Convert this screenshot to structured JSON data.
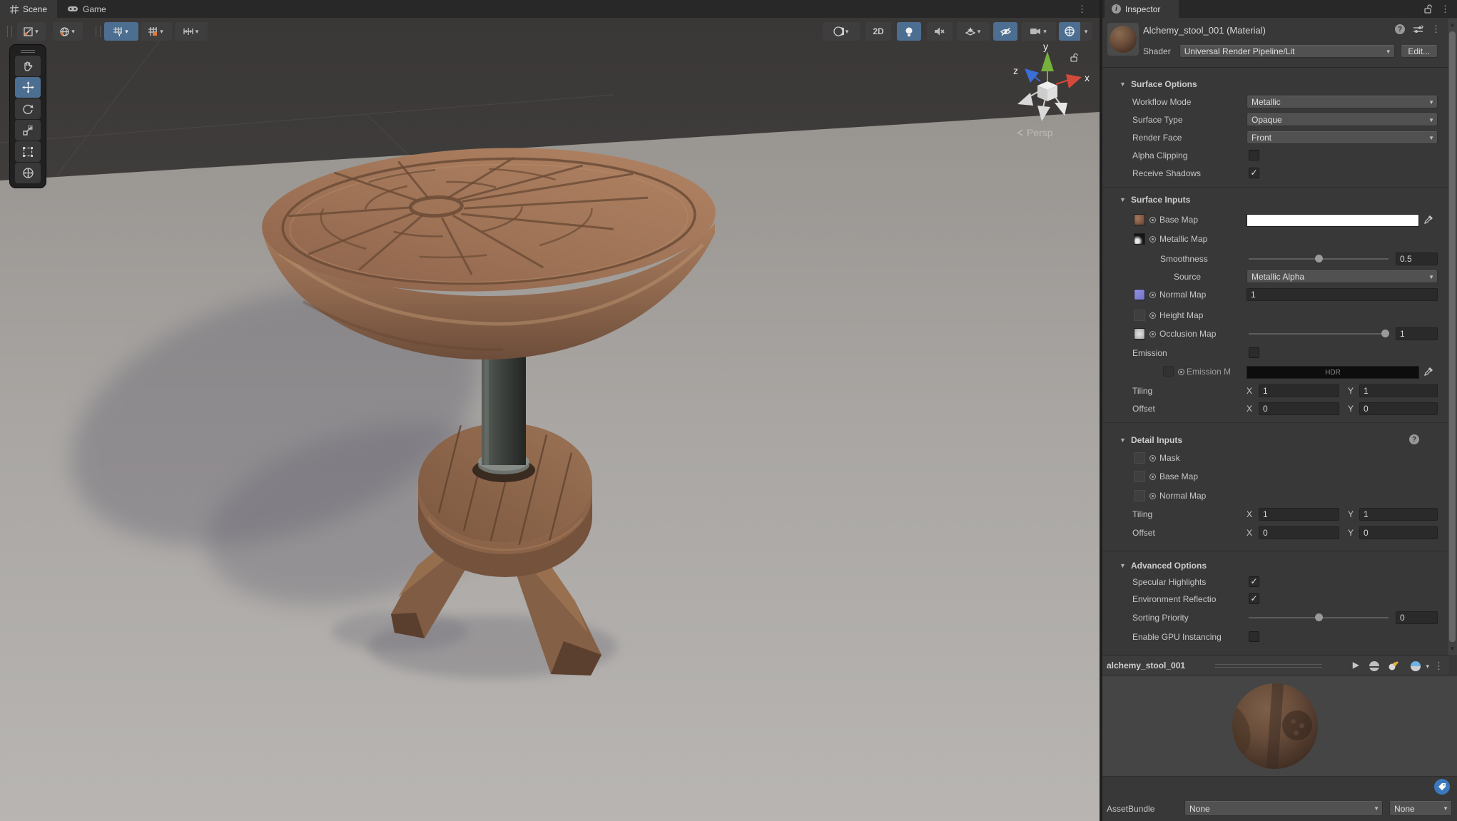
{
  "colors": {
    "accent_blue": "#4c6e91",
    "panel_bg": "#383838",
    "tabbar_bg": "#282828",
    "axis_x_red": "#d44a3a",
    "axis_y_green": "#76b13c",
    "axis_z_blue": "#3a6fd8",
    "tag_blue": "#3a79bd",
    "base_map_swatch": "#ffffff",
    "emission_swatch": "#0d0d0d"
  },
  "scene": {
    "tabs": {
      "scene": "Scene",
      "game": "Game"
    },
    "toolbar": {
      "btn_2d": "2D"
    },
    "gizmo": {
      "x": "x",
      "y": "y",
      "z": "z",
      "persp": "Persp"
    }
  },
  "inspector": {
    "tab": "Inspector",
    "header": {
      "title": "Alchemy_stool_001 (Material)",
      "shader_label": "Shader",
      "shader_value": "Universal Render Pipeline/Lit",
      "edit_button": "Edit..."
    },
    "surface_options": {
      "title": "Surface Options",
      "workflow_mode": {
        "label": "Workflow Mode",
        "value": "Metallic"
      },
      "surface_type": {
        "label": "Surface Type",
        "value": "Opaque"
      },
      "render_face": {
        "label": "Render Face",
        "value": "Front"
      },
      "alpha_clipping": {
        "label": "Alpha Clipping",
        "check": ""
      },
      "receive_shadows": {
        "label": "Receive Shadows",
        "check": "✓"
      }
    },
    "surface_inputs": {
      "title": "Surface Inputs",
      "base_map": {
        "label": "Base Map"
      },
      "metallic_map": {
        "label": "Metallic Map"
      },
      "smoothness": {
        "label": "Smoothness",
        "value": "0.5"
      },
      "source": {
        "label": "Source",
        "value": "Metallic Alpha"
      },
      "normal_map": {
        "label": "Normal Map",
        "value": "1"
      },
      "height_map": {
        "label": "Height Map"
      },
      "occlusion_map": {
        "label": "Occlusion Map",
        "value": "1"
      },
      "emission": {
        "label": "Emission",
        "check": ""
      },
      "emission_map": {
        "label": "Emission M",
        "hdr_badge": "HDR"
      },
      "tiling": {
        "label": "Tiling",
        "x_label": "X",
        "x": "1",
        "y_label": "Y",
        "y": "1"
      },
      "offset": {
        "label": "Offset",
        "x_label": "X",
        "x": "0",
        "y_label": "Y",
        "y": "0"
      }
    },
    "detail_inputs": {
      "title": "Detail Inputs",
      "mask": {
        "label": "Mask"
      },
      "base_map": {
        "label": "Base Map"
      },
      "normal_map": {
        "label": "Normal Map"
      },
      "tiling": {
        "label": "Tiling",
        "x_label": "X",
        "x": "1",
        "y_label": "Y",
        "y": "1"
      },
      "offset": {
        "label": "Offset",
        "x_label": "X",
        "x": "0",
        "y_label": "Y",
        "y": "0"
      }
    },
    "advanced_options": {
      "title": "Advanced Options",
      "specular_highlights": {
        "label": "Specular Highlights",
        "check": "✓"
      },
      "environment_reflections": {
        "label": "Environment Reflectio",
        "check": "✓"
      },
      "sorting_priority": {
        "label": "Sorting Priority",
        "value": "0"
      },
      "gpu_instancing": {
        "label": "Enable GPU Instancing",
        "check": ""
      }
    },
    "preview": {
      "title": "alchemy_stool_001"
    },
    "asset_bundle": {
      "label": "AssetBundle",
      "bundle_value": "None",
      "variant_value": "None"
    }
  }
}
